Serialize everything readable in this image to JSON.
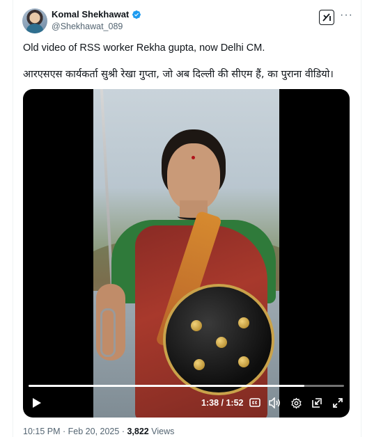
{
  "author": {
    "name": "Komal Shekhawat",
    "handle": "@Shekhawat_089",
    "verified_color": "#1d9bf0"
  },
  "post": {
    "text_en": "Old video of RSS worker Rekha gupta, now Delhi CM.",
    "text_hi": "आरएसएस कार्यकर्ता  सुश्री रेखा गुप्ता,  जो अब दिल्ली की सीएम हैं, का पुराना वीडियो।"
  },
  "video": {
    "time_current": "1:38",
    "time_separator": "/",
    "time_total": "1:52",
    "progress_fraction": 0.875,
    "controls": [
      "play-icon",
      "captions-icon",
      "volume-icon",
      "settings-icon",
      "pip-icon",
      "fullscreen-icon"
    ]
  },
  "meta": {
    "time": "10:15 PM",
    "date": "Feb 20, 2025",
    "separator": "·",
    "views_count": "3,822",
    "views_label": "Views"
  },
  "icons": {
    "more": "more-dots-icon",
    "grok": "grok-icon"
  }
}
